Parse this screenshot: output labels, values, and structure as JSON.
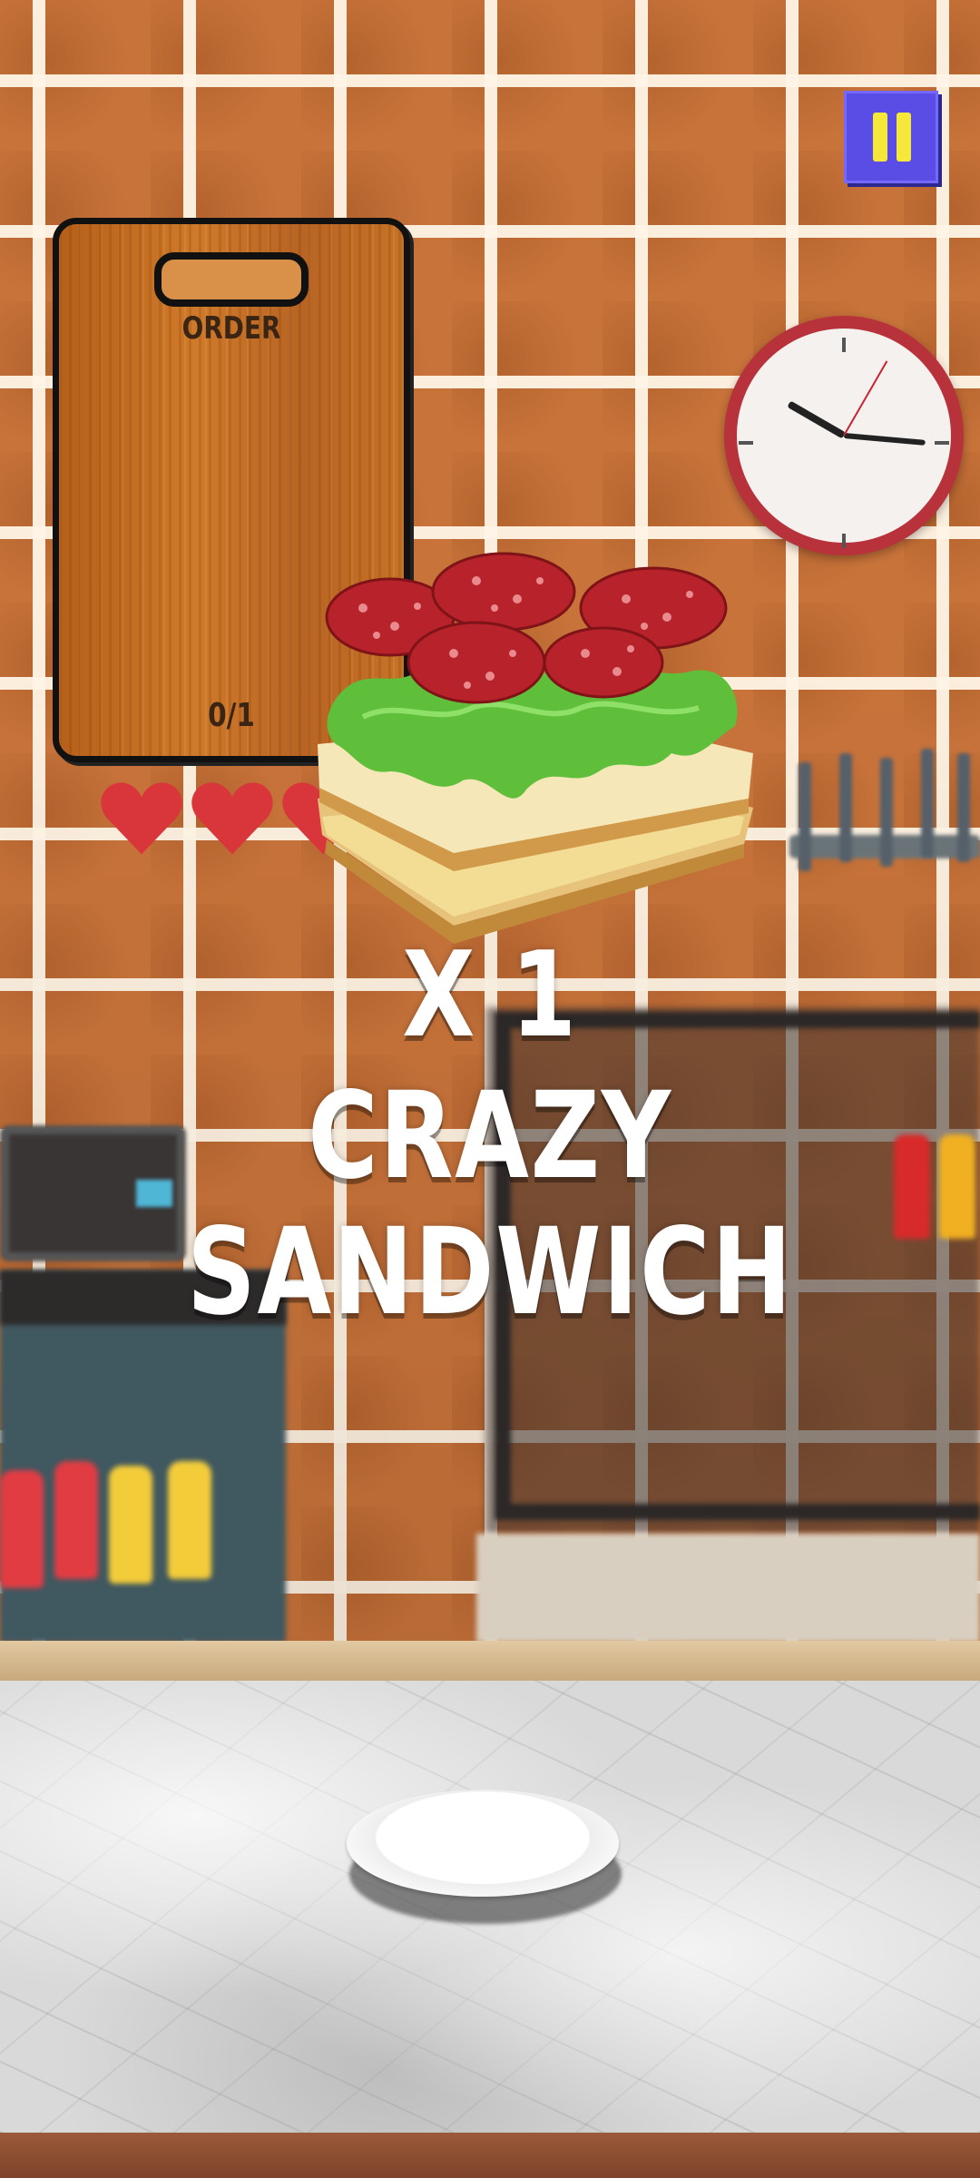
{
  "order_board": {
    "title": "ORDER",
    "progress": "0/1"
  },
  "lives": {
    "hearts": 3,
    "color": "#d8363a"
  },
  "pause_button": {
    "icon": "pause-icon",
    "bg_color": "#5a4de6",
    "icon_color": "#f6e83a"
  },
  "order_announcement": {
    "quantity": "X 1",
    "name_line1": "CRAZY",
    "name_line2": "SANDWICH"
  },
  "sandwich": {
    "ingredients": [
      "bread",
      "cheese",
      "bread",
      "lettuce",
      "salami"
    ]
  }
}
